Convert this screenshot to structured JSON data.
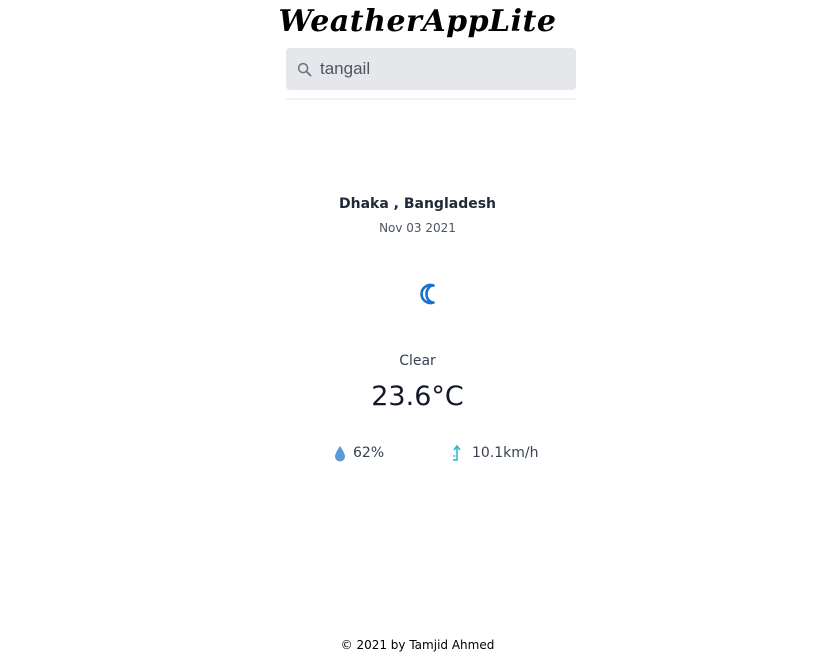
{
  "app": {
    "title": "WeatherAppLite"
  },
  "search": {
    "value": "tangail",
    "icon": "search-icon"
  },
  "weather": {
    "location": "Dhaka , Bangladesh",
    "date": "Nov 03 2021",
    "icon": "moon-icon",
    "condition": "Clear",
    "temperature": "23.6°C",
    "humidity": "62%",
    "humidity_icon": "water-drop-icon",
    "wind": "10.1km/h",
    "wind_icon": "wind-direction-icon"
  },
  "colors": {
    "moon": "#1a6fcf",
    "drop": "#5b9bd5",
    "wind_arrow": "#22b8cf",
    "search_bg": "#e5e7eb"
  },
  "footer": {
    "text": "© 2021 by Tamjid Ahmed"
  }
}
